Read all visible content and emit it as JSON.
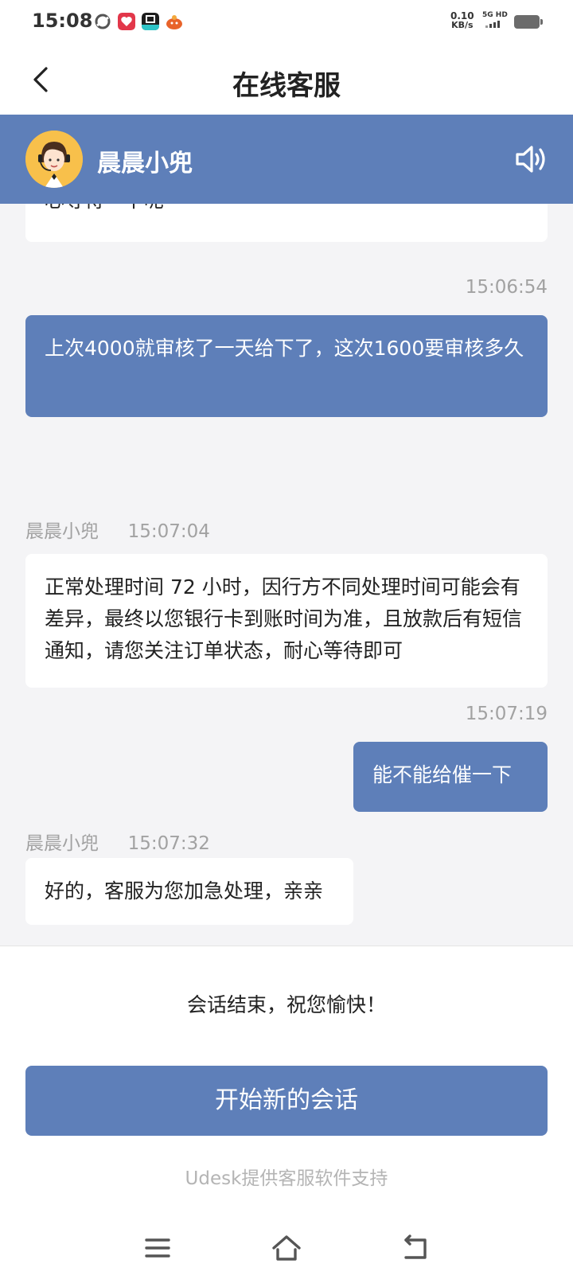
{
  "status_bar": {
    "time": "15:08",
    "net_speed_value": "0.10",
    "net_speed_unit": "KB/s",
    "network_type": "5G HD",
    "icons": [
      "link-icon",
      "app-icon-red",
      "app-icon-dark",
      "app-icon-orange",
      "signal-icon",
      "battery-icon"
    ]
  },
  "title_bar": {
    "back_icon": "chevron-left-icon",
    "title": "在线客服"
  },
  "agent": {
    "name": "晨晨小兜",
    "avatar_icon": "agent-avatar-icon",
    "speaker_icon": "speaker-icon"
  },
  "messages": [
    {
      "side": "left",
      "sender": "",
      "time": "",
      "text": "心等待一下呢"
    },
    {
      "side": "right",
      "time": "15:06:54",
      "text": "上次4000就审核了一天给下了，这次1600要审核多久"
    },
    {
      "side": "left",
      "sender": "晨晨小兜",
      "time": "15:07:04",
      "text": "正常处理时间 72 小时，因行方不同处理时间可能会有差异，最终以您银行卡到账时间为准，且放款后有短信通知，请您关注订单状态，耐心等待即可"
    },
    {
      "side": "right",
      "time": "15:07:19",
      "text": "能不能给催一下"
    },
    {
      "side": "left",
      "sender": "晨晨小兜",
      "time": "15:07:32",
      "text": "好的，客服为您加急处理，亲亲"
    }
  ],
  "footer": {
    "ended_text": "会话结束，祝您愉快！",
    "new_session_label": "开始新的会话",
    "support_text": "Udesk提供客服软件支持"
  },
  "nav_bar": {
    "icons": [
      "menu-icon",
      "home-icon",
      "back-icon"
    ]
  },
  "colors": {
    "accent": "#5e7fb9",
    "background": "#f4f4f6",
    "meta_text": "#a2a2a2"
  }
}
